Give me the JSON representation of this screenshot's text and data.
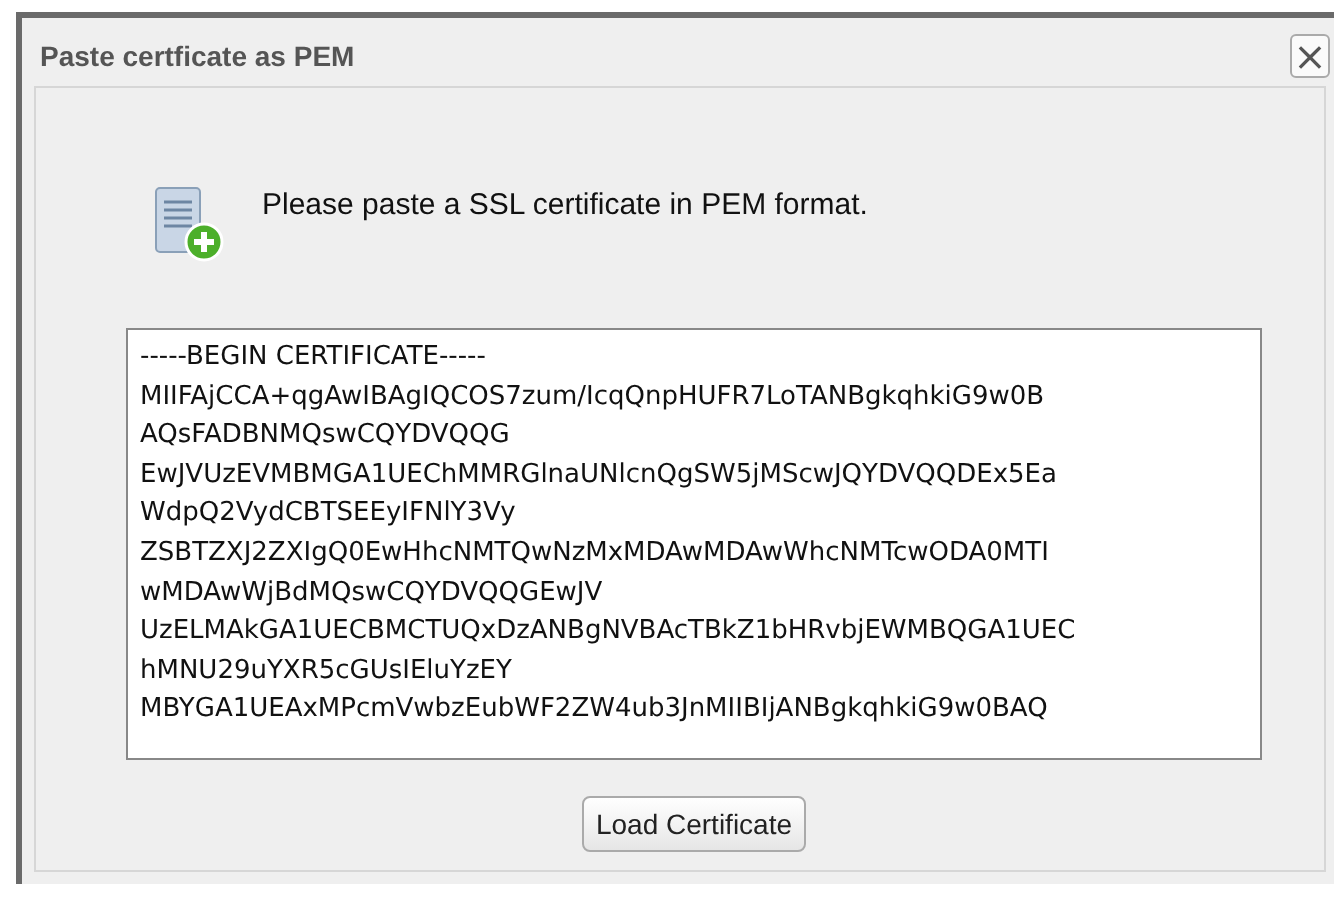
{
  "dialog": {
    "title": "Paste certficate as PEM",
    "close": "×"
  },
  "message": "Please paste a SSL certificate in PEM format.",
  "certificate_field": {
    "value": "-----BEGIN CERTIFICATE-----\nMIIFAjCCA+qgAwIBAgIQCOS7zum/IcqQnpHUFR7LoTANBgkqhkiG9w0B\nAQsFADBNMQswCQYDVQQG\nEwJVUzEVMBMGA1UEChMMRGlnaUNlcnQgSW5jMScwJQYDVQQDEx5Ea\nWdpQ2VydCBTSEEyIFNlY3Vy\nZSBTZXJ2ZXIgQ0EwHhcNMTQwNzMxMDAwMDAwWhcNMTcwODA0MTI\nwMDAwWjBdMQswCQYDVQQGEwJV\nUzELMAkGA1UECBMCTUQxDzANBgNVBAcTBkZ1bHRvbjEWMBQGA1UEC\nhMNU29uYXR5cGUsIEluYzEY\nMBYGA1UEAxMPcmVwbzEubWF2ZW4ub3JnMIIBIjANBgkqhkiG9w0BAQ"
  },
  "buttons": [
    "Load Certificate"
  ]
}
